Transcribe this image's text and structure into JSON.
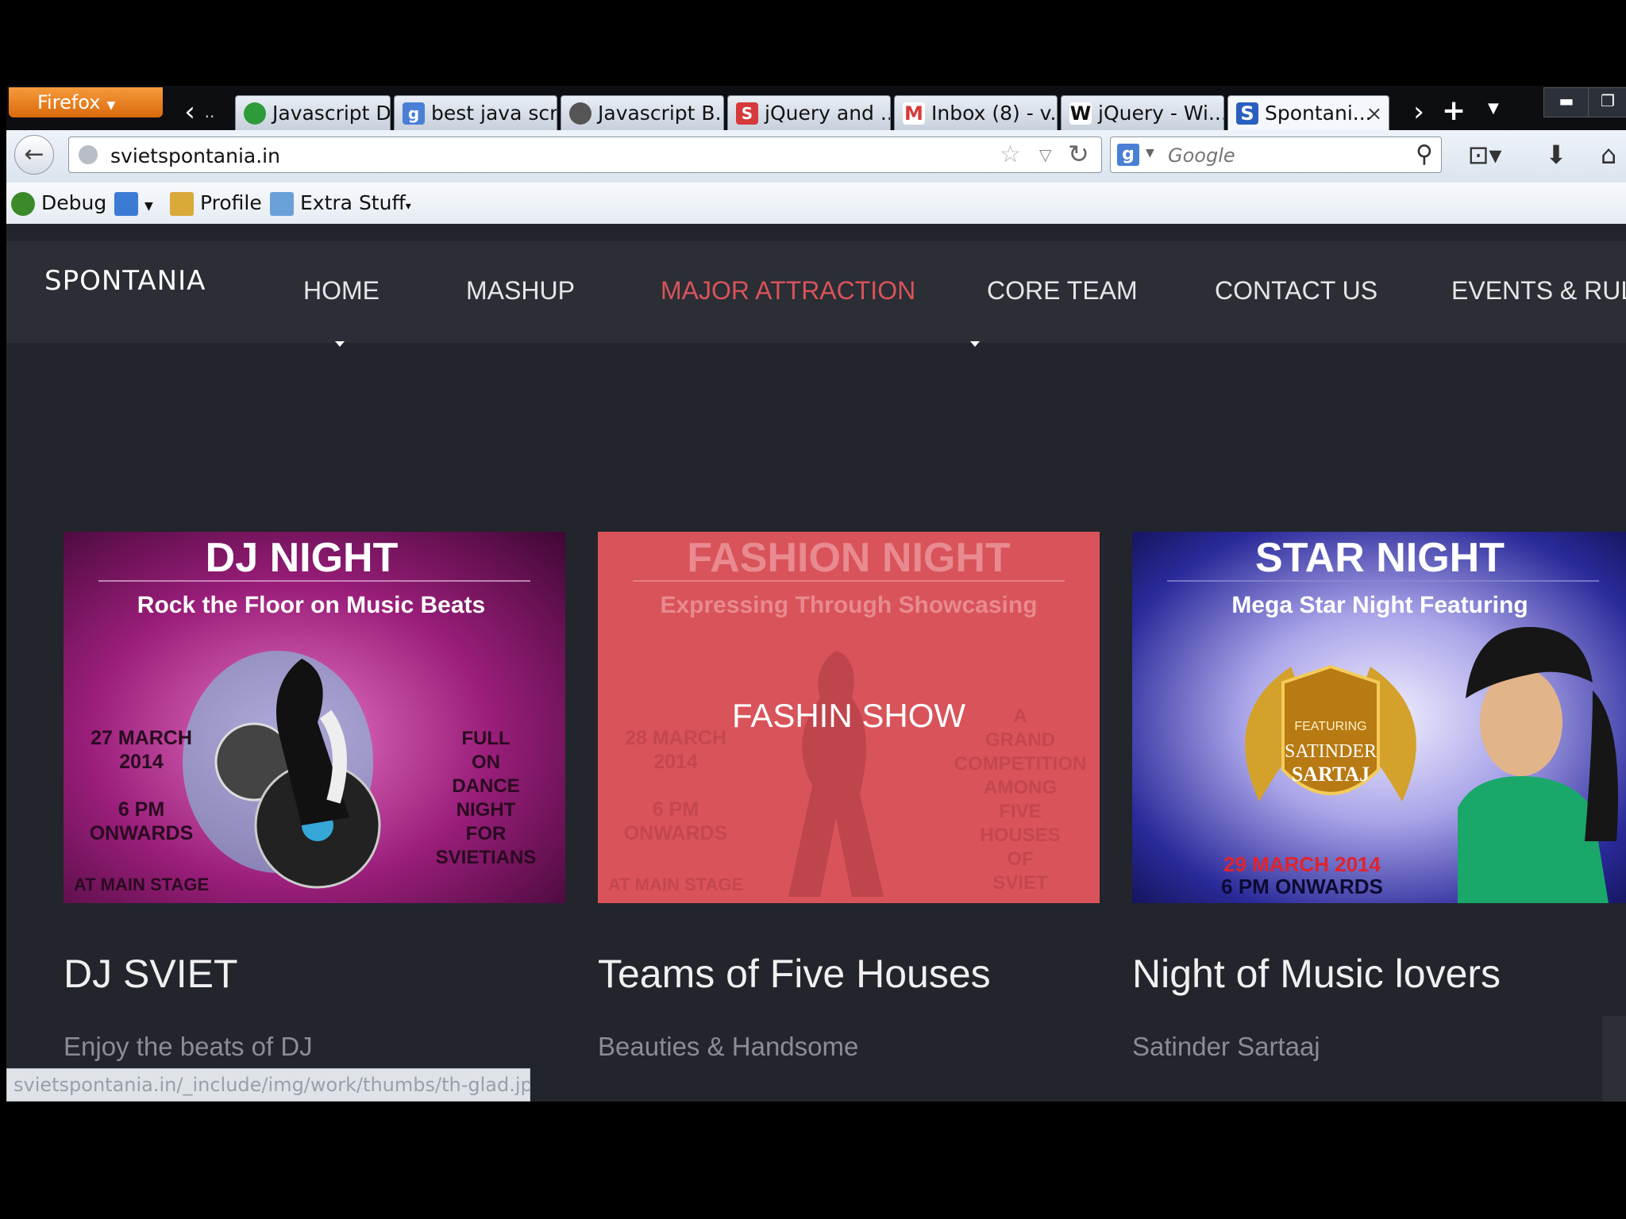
{
  "browser": {
    "menu_label": "Firefox",
    "tabs": [
      {
        "title": "Javascript D..."
      },
      {
        "title": "best java scr..."
      },
      {
        "title": "Javascript B..."
      },
      {
        "title": "jQuery and ..."
      },
      {
        "title": "Inbox (8) - v..."
      },
      {
        "title": "jQuery - Wi..."
      },
      {
        "title": "Spontani..."
      }
    ],
    "url": "svietspontania.in",
    "search_placeholder": "Google",
    "bookmarks": [
      {
        "label": "Debug"
      },
      {
        "label": "Profile"
      },
      {
        "label": "Extra Stuff"
      }
    ],
    "status_url": "svietspontania.in/_include/img/work/thumbs/th-glad.jpg"
  },
  "site": {
    "logo": "SPONTANIA",
    "menu": [
      "HOME",
      "MASHUP",
      "MAJOR ATTRACTION",
      "CORE TEAM",
      "CONTACT US",
      "EVENTS & RULI"
    ],
    "active_menu_index": 2,
    "accent_color": "#d9535a",
    "cards": [
      {
        "title": "DJ SVIET",
        "subtitle": "Enjoy the beats of DJ",
        "poster": {
          "heading": "DJ NIGHT",
          "tagline": "Rock the Floor on Music Beats",
          "date1": "27 MARCH",
          "date2": "2014",
          "time1": "6 PM",
          "time2": "ONWARDS",
          "venue": "AT MAIN STAGE",
          "side": [
            "FULL",
            "ON",
            "DANCE",
            "NIGHT",
            "FOR",
            "SVIETIANS"
          ]
        }
      },
      {
        "title": "Teams of Five Houses",
        "subtitle": "Beauties & Handsome",
        "overlay": "FASHIN SHOW",
        "poster": {
          "heading": "FASHION NIGHT",
          "tagline": "Expressing Through Showcasing",
          "date1": "28 MARCH",
          "date2": "2014",
          "time1": "6 PM",
          "time2": "ONWARDS",
          "venue": "AT MAIN STAGE",
          "side": [
            "A",
            "GRAND",
            "COMPETITION",
            "AMONG",
            "FIVE",
            "HOUSES",
            "OF",
            "SVIET"
          ]
        }
      },
      {
        "title": "Night of Music lovers",
        "subtitle": "Satinder Sartaaj",
        "poster": {
          "heading": "STAR NIGHT",
          "tagline": "Mega Star Night Featuring",
          "badge_top": "FEATURING",
          "badge_name1": "SATINDER",
          "badge_name2": "SARTAJ",
          "date": "29 MARCH 2014",
          "time": "6 PM ONWARDS"
        }
      }
    ]
  }
}
